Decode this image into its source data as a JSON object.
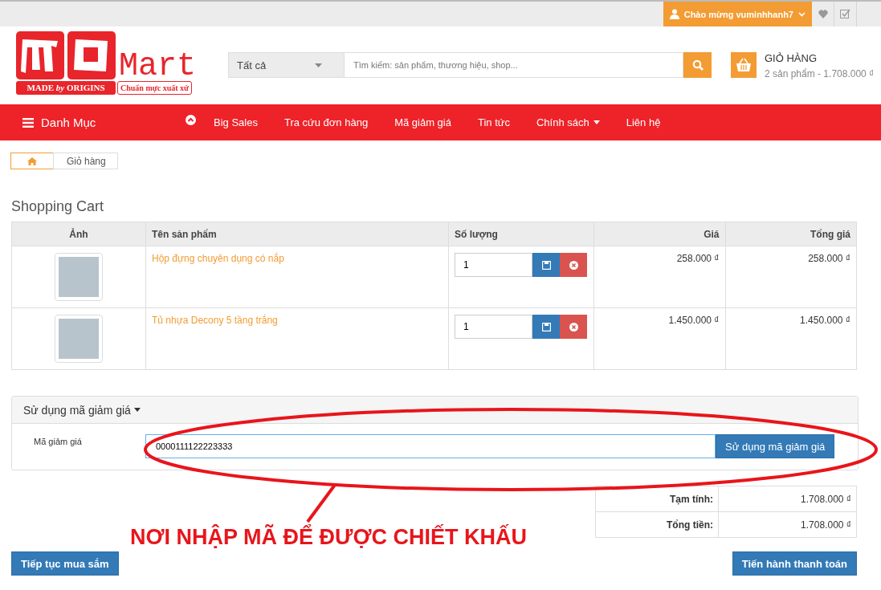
{
  "topbar": {
    "greeting": "Chào mừng vuminhhanh7"
  },
  "logo": {
    "name": "Mart",
    "badge": "MADE *by* ORIGINS",
    "tagline": "Chuẩn mực xuất xứ"
  },
  "search": {
    "category": "Tất cả",
    "placeholder": "Tìm kiếm: sản phẩm, thương hiệu, shop..."
  },
  "cart_summary": {
    "title": "GIỎ HÀNG",
    "summary": "2 sản phẩm - 1.708.000 ₫"
  },
  "nav": {
    "menu": "Danh Mục",
    "items": [
      {
        "label": "Big Sales",
        "kind": "link"
      },
      {
        "label": "Tra cứu đơn hàng",
        "kind": "link"
      },
      {
        "label": "Mã giảm giá",
        "kind": "link"
      },
      {
        "label": "Tin tức",
        "kind": "link"
      },
      {
        "label": "Chính sách",
        "kind": "dropdown"
      },
      {
        "label": "Liên hệ",
        "kind": "link"
      }
    ]
  },
  "breadcrumb": [
    "Giỏ hàng"
  ],
  "heading": "Shopping Cart",
  "table": {
    "columns": [
      "Ảnh",
      "Tên sản phẩm",
      "Số lượng",
      "Giá",
      "Tổng giá"
    ],
    "rows": [
      {
        "name": "Hộp đựng chuyên dụng có nắp",
        "quantity": "1",
        "price": "258.000 ₫",
        "total": "258.000 ₫"
      },
      {
        "name": "Tủ nhựa Decony 5 tầng trắng",
        "quantity": "1",
        "price": "1.450.000 ₫",
        "total": "1.450.000 ₫"
      }
    ]
  },
  "coupon": {
    "title": "Sử dụng mã giảm giá",
    "label": "Mã giảm giá",
    "value": "0000111122223333",
    "button": "Sử dụng mã giảm giá"
  },
  "totals": [
    {
      "label": "Tạm tính:",
      "value": "1.708.000 ₫"
    },
    {
      "label": "Tổng tiền:",
      "value": "1.708.000 ₫"
    }
  ],
  "buttons": {
    "continue": "Tiếp tục mua sắm",
    "checkout": "Tiến hành thanh toán"
  },
  "annotation": {
    "caption": "NƠI NHẬP MÃ ĐỂ ĐƯỢC CHIẾT KHẤU"
  }
}
